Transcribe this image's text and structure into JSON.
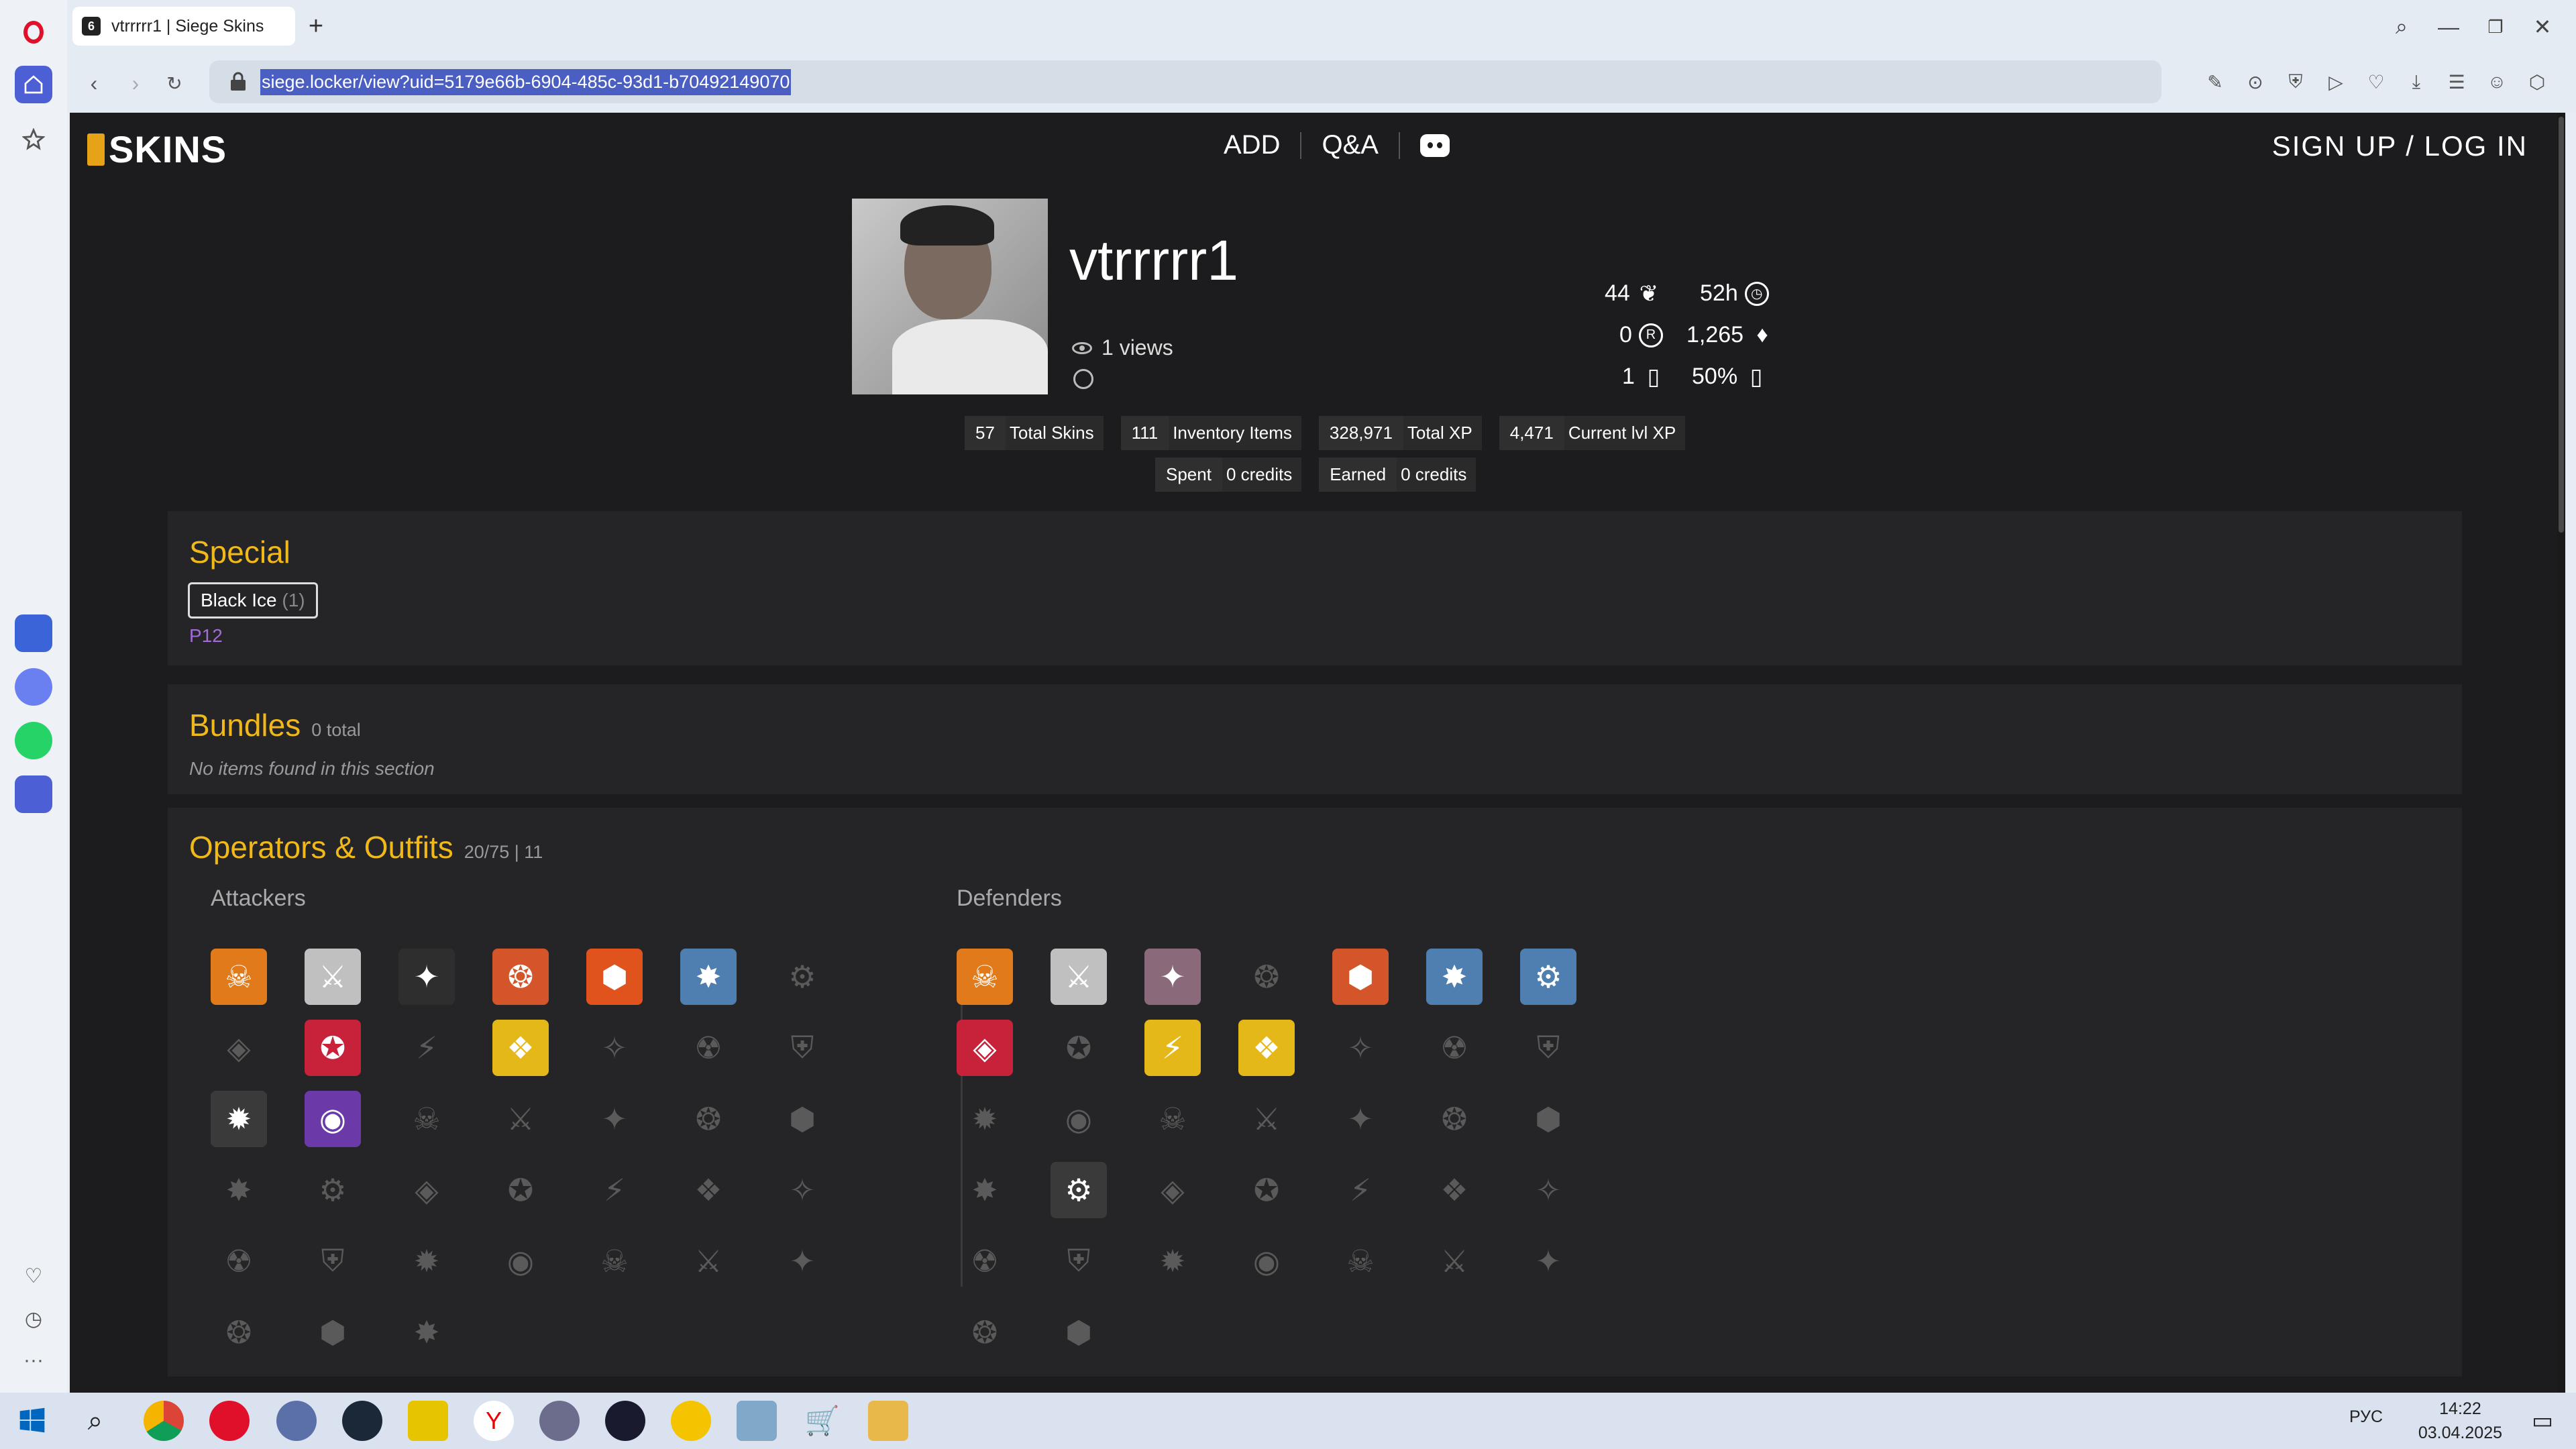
{
  "browser": {
    "tab_title": "vtrrrrr1 | Siege Skins",
    "url": "siege.locker/view?uid=5179e66b-6904-485c-93d1-b704921490​70"
  },
  "site": {
    "logo": "SKINS",
    "nav": [
      "ADD",
      "Q&A"
    ],
    "auth": "SIGN UP / LOG IN"
  },
  "profile": {
    "username": "vtrrrrr1",
    "views": "1 views",
    "stats": {
      "level": "44",
      "playtime": "52h",
      "credits": "0",
      "renown": "1,265",
      "alpha_packs": "1",
      "alpha_chance": "50%"
    },
    "pills": [
      {
        "num": "57",
        "label": "Total Skins"
      },
      {
        "num": "111",
        "label": "Inventory Items"
      },
      {
        "num": "328,971",
        "label": "Total XP"
      },
      {
        "num": "4,471",
        "label": "Current lvl XP"
      }
    ],
    "spent": {
      "label": "Spent",
      "value": "0 credits"
    },
    "earned": {
      "label": "Earned",
      "value": "0 credits"
    }
  },
  "sections": {
    "special": {
      "title": "Special",
      "chip": "Black Ice",
      "chip_count": "(1)",
      "item": "P12"
    },
    "bundles": {
      "title": "Bundles",
      "sub": "0 total",
      "empty": "No items found in this section"
    },
    "operators": {
      "title": "Operators & Outfits",
      "sub": "20/75 | 11",
      "attackers_label": "Attackers",
      "defenders_label": "Defenders"
    }
  },
  "taskbar": {
    "time": "14:22",
    "date": "03.04.2025",
    "lang": "РУС"
  }
}
